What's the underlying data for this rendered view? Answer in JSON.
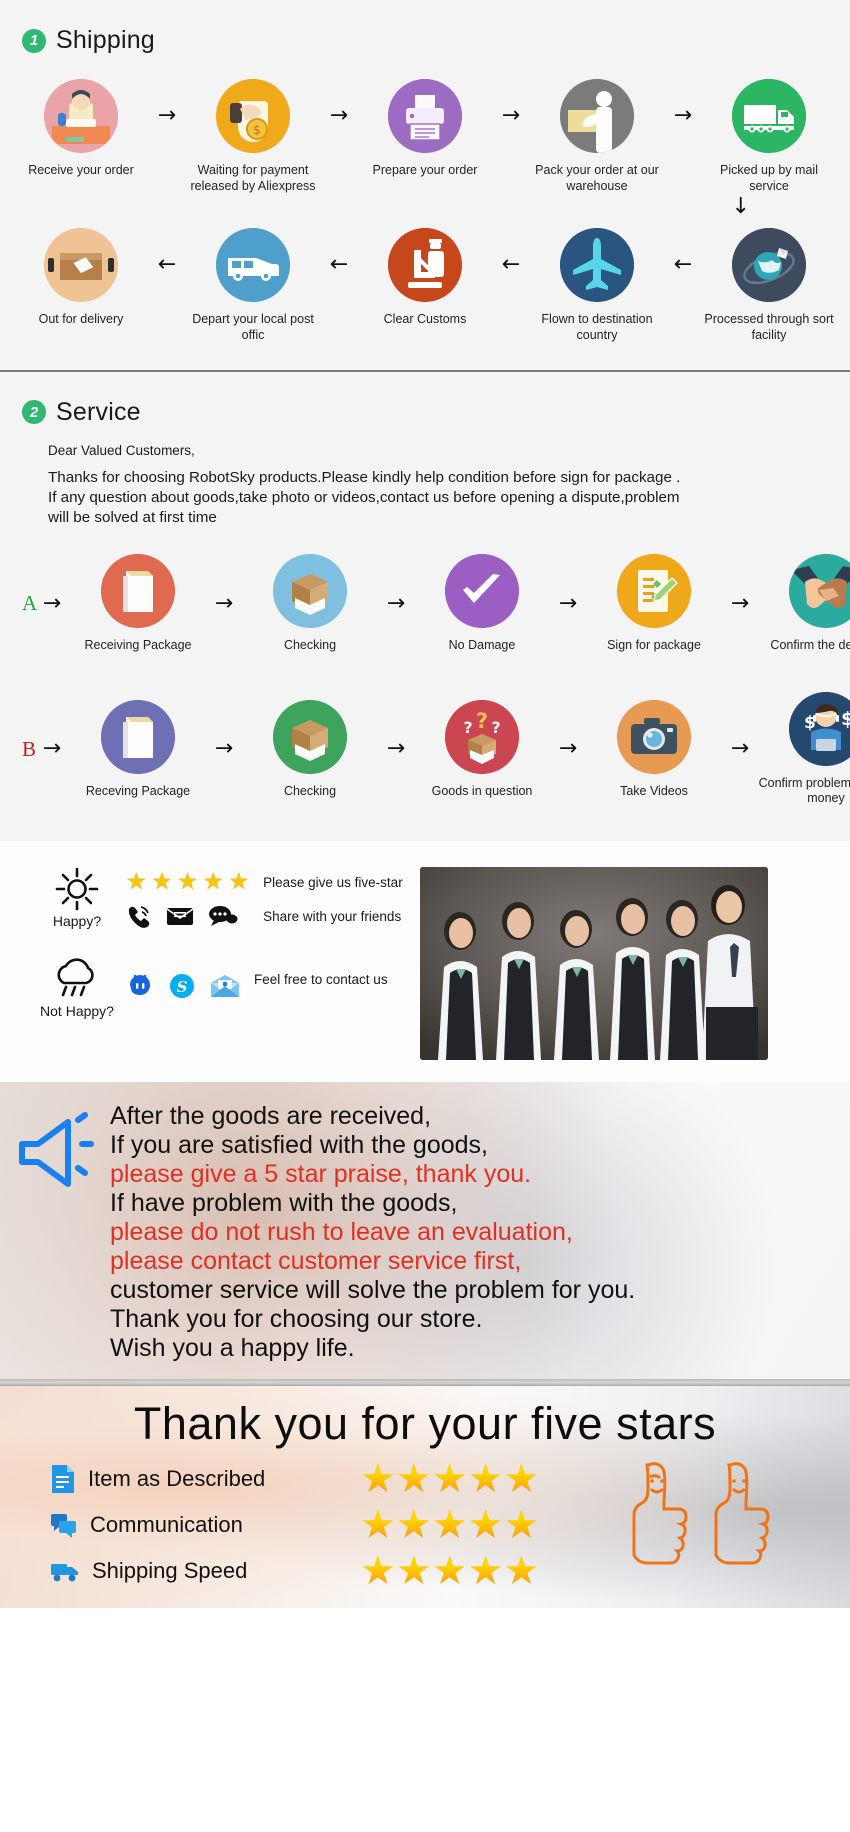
{
  "sections": {
    "shipping": {
      "number": "1",
      "title": "Shipping",
      "row1": [
        {
          "label": "Receive your order",
          "icon": "person-at-desk-icon",
          "color": "#eaa3a7"
        },
        {
          "label": "Waiting for payment released by Aliexpress",
          "icon": "hand-coin-icon",
          "color": "#f0a91b"
        },
        {
          "label": "Prepare your order",
          "icon": "printer-icon",
          "color": "#9b6cc2"
        },
        {
          "label": "Pack your order at our warehouse",
          "icon": "worker-package-icon",
          "color": "#7b7b7b"
        },
        {
          "label": "Picked up by mail service",
          "icon": "delivery-truck-icon",
          "color": "#2cb563"
        }
      ],
      "row2": [
        {
          "label": "Out for delivery",
          "icon": "parcel-box-icon",
          "color": "#f0c395"
        },
        {
          "label": "Depart your local post offic",
          "icon": "delivery-van-icon",
          "color": "#4f9fcb"
        },
        {
          "label": "Clear  Customs",
          "icon": "customs-officer-icon",
          "color": "#c6471c"
        },
        {
          "label": "Flown to destination country",
          "icon": "airplane-icon",
          "color": "#2a5580"
        },
        {
          "label": "Processed through sort facility",
          "icon": "globe-sorting-icon",
          "color": "#3e4a5e"
        }
      ],
      "arrow_right": "→",
      "arrow_left": "←",
      "arrow_down": "↓"
    },
    "service": {
      "number": "2",
      "title": "Service",
      "salutation": "Dear Valued Customers,",
      "body_lines": [
        "Thanks for choosing RobotSky products.Please kindly help condition before sign for package .",
        "If any question about goods,take photo or videos,contact us before opening a dispute,problem",
        "will be solved at first time"
      ],
      "rowA": {
        "letter": "A",
        "steps": [
          {
            "label": "Receiving Package",
            "icon": "book-package-icon",
            "color": "#e06a50"
          },
          {
            "label": "Checking",
            "icon": "open-box-icon",
            "color": "#7fc0e0"
          },
          {
            "label": "No Damage",
            "icon": "check-mark-icon",
            "color": "#9b5fc4"
          },
          {
            "label": "Sign for package",
            "icon": "signed-document-icon",
            "color": "#f0a81b"
          },
          {
            "label": "Confirm the delivery",
            "icon": "handshake-icon",
            "color": "#2bab9e"
          }
        ]
      },
      "rowB": {
        "letter": "B",
        "steps": [
          {
            "label": "Receving Package",
            "icon": "book-package-icon",
            "color": "#6f6fb5"
          },
          {
            "label": "Checking",
            "icon": "open-box-icon",
            "color": "#3da35d"
          },
          {
            "label": "Goods in question",
            "icon": "question-box-icon",
            "color": "#cb4651"
          },
          {
            "label": "Take Videos",
            "icon": "camera-icon",
            "color": "#e79a52"
          },
          {
            "label": "Confirm problem, refund money",
            "icon": "support-agent-money-icon",
            "color": "#25486e"
          }
        ]
      }
    },
    "feedback": {
      "happy": {
        "mood_icon": "sun-icon",
        "mood_label": "Happy?",
        "star_count": 5,
        "star_glyph": "★",
        "line1_text": "Please give us five-star",
        "line2_text": "Share with your friends",
        "contact_icons": [
          "phone-ring-icon",
          "envelope-icon",
          "chat-bubble-icon"
        ]
      },
      "not_happy": {
        "mood_icon": "rain-cloud-icon",
        "mood_label": "Not Happy?",
        "line_text": "Feel free to contact us",
        "contact_icons": [
          "aliwangwang-icon",
          "skype-icon",
          "open-mail-icon"
        ]
      },
      "photo_alt": "customer-service-team-photo"
    },
    "megaphone": {
      "icon": "megaphone-icon",
      "lines": [
        {
          "text": "After the goods are received,",
          "color": "black"
        },
        {
          "text": "If you are satisfied with the goods,",
          "color": "black"
        },
        {
          "text": "please give a 5 star praise, thank you.",
          "color": "red"
        },
        {
          "text": "If have problem with the goods,",
          "color": "black"
        },
        {
          "text": "please do not rush to leave an evaluation,",
          "color": "red"
        },
        {
          "text": "please contact customer service first,",
          "color": "red"
        },
        {
          "text": "customer service will solve the problem for you.",
          "color": "black"
        },
        {
          "text": "Thank you for choosing our store.",
          "color": "black"
        },
        {
          "text": "Wish you a happy life.",
          "color": "black"
        }
      ],
      "red_hex": "#e03023"
    },
    "thanks": {
      "title": "Thank you for your five stars",
      "rows": [
        {
          "icon": "document-icon",
          "label": "Item as Described",
          "stars": 5
        },
        {
          "icon": "chat-icon",
          "label": "Communication",
          "stars": 5
        },
        {
          "icon": "truck-icon",
          "label": "Shipping  Speed",
          "stars": 5
        }
      ],
      "star_glyph": "★",
      "thumbs_icon": "thumbs-up-pair-icon"
    }
  },
  "colors": {
    "accent_green": "#2eb872",
    "section_bg": "#f4f4f4",
    "star_yellow": "#f7c50a",
    "star_orange": "#f78b1e",
    "megaphone_blue": "#1a7ff0"
  }
}
